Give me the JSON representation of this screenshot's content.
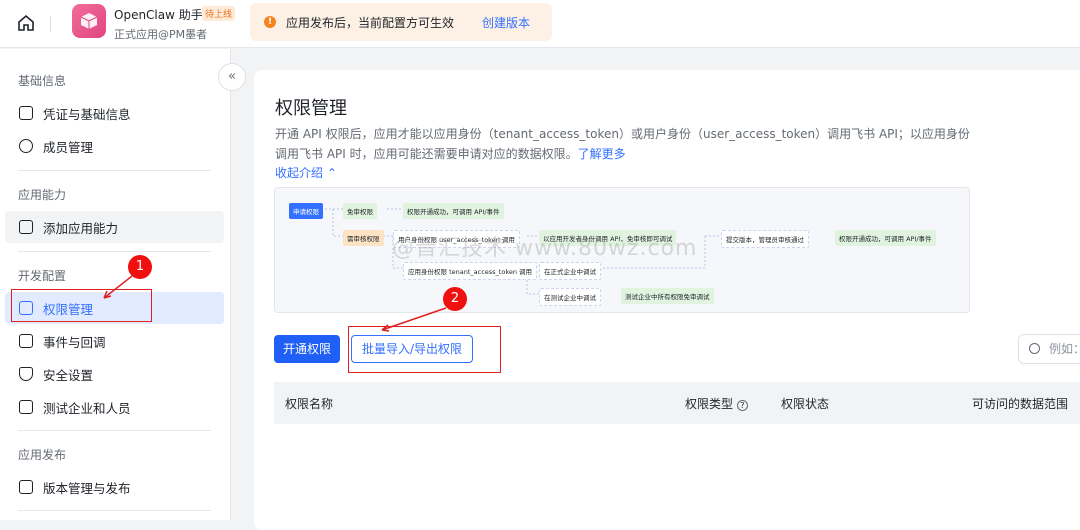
{
  "header": {
    "app_name": "OpenClaw 助手",
    "status_badge": "待上线",
    "app_subtitle": "正式应用@PM墨者",
    "notice": "应用发布后，当前配置方可生效",
    "notice_link": "创建版本"
  },
  "sidebar": {
    "sections": [
      {
        "title": "基础信息",
        "items": [
          {
            "label": "凭证与基础信息"
          },
          {
            "label": "成员管理"
          }
        ]
      },
      {
        "title": "应用能力",
        "items": [
          {
            "label": "添加应用能力"
          }
        ]
      },
      {
        "title": "开发配置",
        "items": [
          {
            "label": "权限管理"
          },
          {
            "label": "事件与回调"
          },
          {
            "label": "安全设置"
          },
          {
            "label": "测试企业和人员"
          }
        ]
      },
      {
        "title": "应用发布",
        "items": [
          {
            "label": "版本管理与发布"
          }
        ]
      }
    ]
  },
  "main": {
    "title": "权限管理",
    "description": "开通 API 权限后，应用才能以应用身份（tenant_access_token）或用户身份（user_access_token）调用飞书 API；以应用身份调用飞书 API 时，应用可能还需要申请对应的数据权限。",
    "learn_more": "了解更多",
    "collapse_intro": "收起介绍",
    "diagram": {
      "apply": "申请权限",
      "no_review": "免审权限",
      "success1": "权限开通成功，可调用 API/事件",
      "need_review": "需审核权限",
      "user_perm": "用户身份权限 user_access_token 调用",
      "dev_debug": "以应用开发者身份调用 API，免审核即可调试",
      "submit": "提交版本，管理员审核通过",
      "success2": "权限开通成功，可调用 API/事件",
      "app_perm": "应用身份权限 tenant_access_token 调用",
      "formal": "在正式企业中调试",
      "test": "在测试企业中调试",
      "test_free": "测试企业中所有权限免审调试"
    },
    "enable_button": "开通权限",
    "batch_button": "批量导入/导出权限",
    "search_placeholder": "例如：",
    "columns": [
      "权限名称",
      "权限类型",
      "权限状态",
      "可访问的数据范围"
    ]
  },
  "annotations": {
    "step1": "1",
    "step2": "2",
    "watermark": "@晋汇技术 www.80wz.com"
  }
}
